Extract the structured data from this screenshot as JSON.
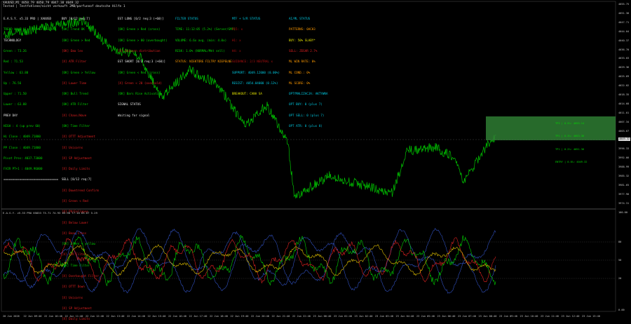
{
  "window": {
    "symbol_line": "XAUUSD,M1 4050.79 4050.79 4047.38 4049.32",
    "ea_line": "Tested | Testfohlene/nicht verkauft 2MB/parfunnof deutsche Hilfe 1"
  },
  "panel_easy": {
    "title": "E.A.S.Y. v5.33 PRO | XAUUSD",
    "trend_line": "TREND H4 = H1 + M15 => NEUTRAL",
    "section1": "TECHNOLOGY",
    "items": [
      "Green : 73.26",
      "Red : 71.53",
      "Yellow : 63.88",
      "Up : 76.56",
      "Upper : 71.50",
      "Lower : 63.88"
    ],
    "section2": "PREV DAY",
    "prev": [
      "HIGH : 4 (up prev 60)",
      "Hi Close : 4049.71800",
      "PP Close : 4049.71800",
      "Pivot Prev: 4037.73000",
      "FAIR PT+1 : 4049.96000"
    ],
    "footer": "==============================="
  },
  "panel_buy": {
    "title": "BUY [0/12 req:7]",
    "items": [
      "[OK] Trend OK",
      "[OK] Green > Red",
      "[OK] Ema lev",
      "[X] ATR Filter",
      "[OK] Green > Yellow",
      "[X] Lower Time",
      "[OK] Bull Trend",
      "[OK] ATR Filter",
      "[X] Chaos/Wave",
      "[OK] Time Filter",
      "[X] OTTT Adjustment",
      "[X] Unicorns",
      "[X] SP Adjustment",
      "[X] Daily Limits"
    ],
    "sell_title": "SELL [0/12 req:7]",
    "sell_items": [
      "[X] Downtrend Confirm",
      "[X] Green < Red",
      "[X] PV/Collapse",
      "[X] Below Lower",
      "[X] Bear Cross",
      "[OK] Green < yellow",
      "[X] ATR Filter",
      "[OK] Time Filter",
      "[X] Overbought Filter",
      "[X] OTTT Down",
      "[X] Unicorns",
      "[X] SP Adjustment",
      "[X] Daily Limits"
    ]
  },
  "panel_estlong": {
    "title": "EST LONG [0/2 req:3 (+60)]",
    "items": [
      "[OK] Green > Red (cross)",
      "[OK] Green > 80 (overbought)",
      "[X] Unicorn distribution"
    ],
    "short_title": "EST SHORT [0/3 req:3 (+60)]",
    "short_items": [
      "[OK] Green < Red (cross)",
      "[X] Green < 20 (oversold)",
      "[OK] Bars Rise Activation"
    ],
    "signal_title": "SIGNAL STATUS",
    "signal_value": "Waiting for signal"
  },
  "panel_filter": {
    "title": "FILTER STATUS",
    "items": [
      "TIME: 11:12:05 (5.2%) (Server/GMT)",
      "VOLUME: 6.6x avg. (min: 4.0x)",
      "RISK: 1.0% (NORMAL/Mkt sell)"
    ],
    "status": "STATUS: NIEKTÓRE FILTRY NIEPEŁNE"
  },
  "panel_mtf": {
    "title": "MTF + S/R STATUS",
    "items": [
      "M15: x",
      "H1: x",
      "H4: x",
      "GUIDANCE: 2/3 NEUTRAL x"
    ],
    "sr": [
      "SUPPORT: 4049.12000 (0.00%)",
      "RESIST: 4054.04000 (0.12%)",
      "BREAKOUT: CANA SA"
    ]
  },
  "panel_ml": {
    "title": "AI/ML STATUS",
    "items": [
      "PATTERNS: 0ACH3",
      "BUY: 50% SLABY*",
      "SELL: ZEGAR 2.7%",
      "ML WIN RATE: 0%",
      "ML COND.: 0%",
      "ML SCORE: 0%"
    ],
    "opt_title": "OPTYMALIZACJA: AKTYWNA",
    "opt": [
      "OPT BUY: 0 (plus 7)",
      "OPT SELL: 0 (plus 7)",
      "OPT ATR: 0 (plus 8)"
    ]
  },
  "tp_zone": {
    "labels": [
      "TP3 | 0.5%: 4055.14",
      "TP2 | 0.3%: 4053.36",
      "TP1 | 0.2%: 4051.36",
      "ENTRY | 0.0%: 4049.32"
    ],
    "entry_tag": "4049.32"
  },
  "indicator": {
    "title": "E.A.S.Y. v5.33 PRO 65833 73.71 74.93 65.96 77.10 63.67 5.29",
    "levels": [
      "80",
      "50",
      "20"
    ],
    "top_label": "100.00",
    "bottom_label": "0.00"
  },
  "price_scale": [
    "4055.75",
    "4051.38",
    "4047.71",
    "4044.04",
    "4040.37",
    "4036.70",
    "4033.03",
    "4029.36",
    "4025.69",
    "4022.02",
    "4018.35",
    "4014.68",
    "4011.01",
    "4007.34",
    "4003.67",
    "4000.00",
    "3996.33",
    "3992.66",
    "3988.99",
    "3985.32",
    "3981.65",
    "3977.98",
    "3974.31"
  ],
  "time_axis": [
    "20 Jun 2026",
    "22 Jun 09:40",
    "22 Jun 10:40",
    "22 Jun 11:40",
    "22 Jun 12:40",
    "22 Jun 13:40",
    "22 Jun 14:40",
    "22 Jun 15:40",
    "22 Jun 16:40",
    "22 Jun 17:40",
    "22 Jun 18:40",
    "22 Jun 19:40",
    "22 Jun 20:40",
    "22 Jun 21:40",
    "22 Jun 22:40",
    "23 Jun 00:40",
    "23 Jun 01:40",
    "23 Jun 02:40",
    "23 Jun 03:40",
    "23 Jun 04:40",
    "23 Jun 05:40",
    "23 Jun 06:40",
    "23 Jun 07:40",
    "23 Jun 08:40",
    "23 Jun 09:40",
    "23 Jun 10:40",
    "23 Jun 11:40",
    "23 Jun 12:40",
    "23 Jun 13:40"
  ],
  "colors": {
    "bg": "#000000",
    "candle": "#00c000",
    "tp_zone": "#2e7d32",
    "grid": "#1e1e1e",
    "green_line": "#00d000",
    "red_line": "#e02020",
    "yellow_line": "#e0c000",
    "blue_band": "#3050c0"
  }
}
